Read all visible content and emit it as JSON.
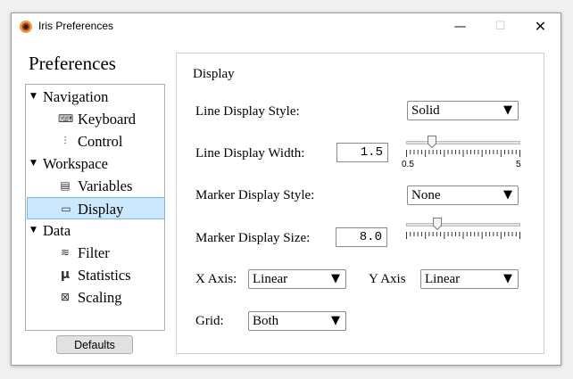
{
  "window": {
    "title": "Iris Preferences",
    "min_glyph": "—",
    "max_glyph": "☐",
    "close_glyph": "✕"
  },
  "sidebar": {
    "title": "Preferences",
    "items": [
      {
        "kind": "category",
        "label": "Navigation",
        "arrow": "▼"
      },
      {
        "kind": "item",
        "label": "Keyboard",
        "icon": "keyboard-icon",
        "glyph": "⌨"
      },
      {
        "kind": "item",
        "label": "Control",
        "icon": "sliders-icon",
        "glyph": "⫶"
      },
      {
        "kind": "category",
        "label": "Workspace",
        "arrow": "▼"
      },
      {
        "kind": "item",
        "label": "Variables",
        "icon": "variables-icon",
        "glyph": "▤"
      },
      {
        "kind": "item",
        "label": "Display",
        "icon": "display-icon",
        "glyph": "▭",
        "selected": true
      },
      {
        "kind": "category",
        "label": "Data",
        "arrow": "▼"
      },
      {
        "kind": "item",
        "label": "Filter",
        "icon": "filter-icon",
        "glyph": "≋"
      },
      {
        "kind": "item",
        "label": "Statistics",
        "icon": "mu-icon",
        "glyph": "μ"
      },
      {
        "kind": "item",
        "label": "Scaling",
        "icon": "scaling-icon",
        "glyph": "⊠"
      }
    ],
    "defaults_label": "Defaults"
  },
  "panel": {
    "title": "Display",
    "line_style": {
      "label": "Line Display Style:",
      "value": "Solid"
    },
    "line_width": {
      "label": "Line Display Width:",
      "value": "1.5",
      "slider_fraction": 0.2,
      "slider_min_label": "0.5",
      "slider_max_label": "5"
    },
    "marker_style": {
      "label": "Marker Display Style:",
      "value": "None"
    },
    "marker_size": {
      "label": "Marker Display Size:",
      "value": "8.0",
      "slider_fraction": 0.25
    },
    "x_axis": {
      "label": "X Axis:",
      "value": "Linear"
    },
    "y_axis": {
      "label": "Y Axis",
      "value": "Linear"
    },
    "grid": {
      "label": "Grid:",
      "value": "Both"
    },
    "caret": "▼"
  }
}
